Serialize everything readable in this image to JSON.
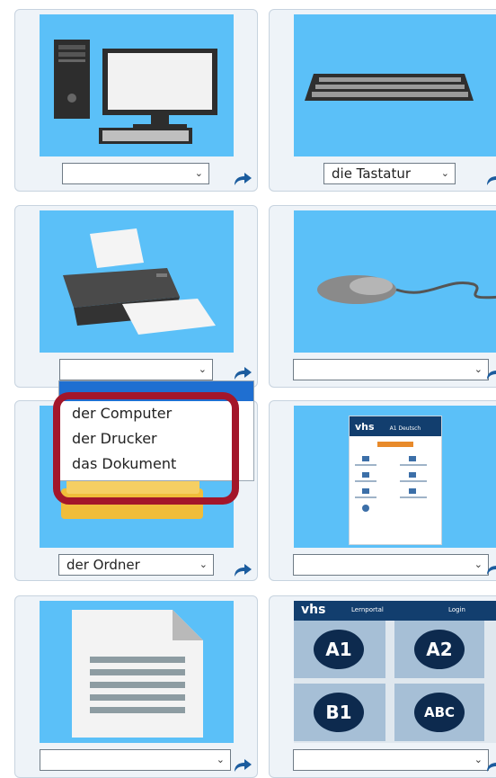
{
  "cards": [
    {
      "name": "computer",
      "select_value": ""
    },
    {
      "name": "keyboard",
      "select_value": "die Tastatur"
    },
    {
      "name": "printer",
      "select_value": ""
    },
    {
      "name": "mouse",
      "select_value": ""
    },
    {
      "name": "folder",
      "select_value": "der Ordner"
    },
    {
      "name": "phone-app",
      "select_value": ""
    },
    {
      "name": "document",
      "select_value": ""
    },
    {
      "name": "levels",
      "select_value": ""
    }
  ],
  "dropdown": {
    "options": [
      "der Computer",
      "der Drucker",
      "das Dokument"
    ]
  },
  "phone": {
    "logo": "vhs",
    "header_text": "A1 Deutsch"
  },
  "levels_panel": {
    "logo": "vhs",
    "title": "Lernportal",
    "login": "Login",
    "levels": [
      "A1",
      "A2",
      "B1",
      "ABC"
    ]
  },
  "colors": {
    "picture_bg": "#5bc0f8",
    "share_icon": "#1b5c9e",
    "highlight_ring": "#a3162a"
  }
}
